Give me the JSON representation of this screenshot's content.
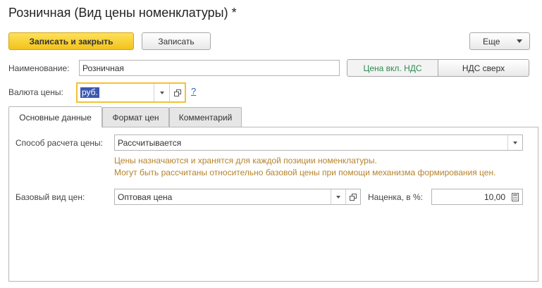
{
  "window": {
    "title": "Розничная (Вид цены номенклатуры) *"
  },
  "toolbar": {
    "save_close_label": "Записать и закрыть",
    "save_label": "Записать",
    "more_label": "Еще"
  },
  "form": {
    "name_label": "Наименование:",
    "name_value": "Розничная",
    "vat_toggle": {
      "options": [
        "Цена вкл. НДС",
        "НДС сверх"
      ],
      "selected": "Цена вкл. НДС"
    },
    "currency_label": "Валюта цены:",
    "currency_value": "руб.",
    "help_label": "?"
  },
  "tabs": [
    {
      "label": "Основные данные",
      "active": true
    },
    {
      "label": "Формат цен",
      "active": false
    },
    {
      "label": "Комментарий",
      "active": false
    }
  ],
  "main": {
    "calc_method_label": "Способ расчета цены:",
    "calc_method_value": "Рассчитывается",
    "hint_line1": "Цены назначаются и хранятся для каждой позиции номенклатуры.",
    "hint_line2": "Могут быть рассчитаны относительно базовой цены при помощи механизма формирования цен.",
    "base_price_label": "Базовый вид цен:",
    "base_price_value": "Оптовая цена",
    "markup_label": "Наценка, в %:",
    "markup_value": "10,00"
  },
  "colors": {
    "primary_button": "#f4c21a",
    "focus_border": "#f2c235",
    "selected_toggle_text": "#2f8a53",
    "hint_text": "#b5832d",
    "help_link": "#2c68c2",
    "selection": "#3c59b0"
  },
  "icons": {
    "dropdown": "chevron-down-icon",
    "open": "open-form-icon",
    "calculator": "calculator-icon"
  }
}
